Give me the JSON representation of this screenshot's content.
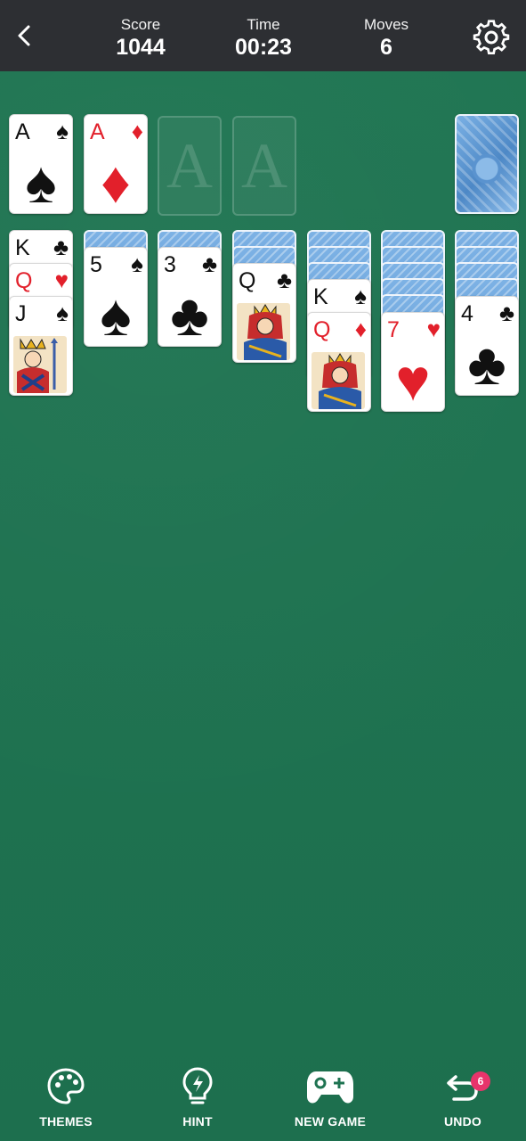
{
  "header": {
    "score_label": "Score",
    "score_value": "1044",
    "time_label": "Time",
    "time_value": "00:23",
    "moves_label": "Moves",
    "moves_value": "6"
  },
  "foundations": [
    {
      "rank": "A",
      "suit": "♠",
      "color": "black"
    },
    {
      "rank": "A",
      "suit": "♦",
      "color": "red"
    },
    {
      "placeholder": "A"
    },
    {
      "placeholder": "A"
    }
  ],
  "tableau": {
    "col1": [
      {
        "rank": "K",
        "suit": "♣"
      },
      {
        "rank": "Q",
        "suit": "♥"
      },
      {
        "rank": "J",
        "suit": "♠"
      }
    ],
    "col2": [
      {
        "rank": "5",
        "suit": "♠"
      }
    ],
    "col3": [
      {
        "rank": "3",
        "suit": "♣"
      }
    ],
    "col4": [
      {
        "rank": "Q",
        "suit": "♣"
      }
    ],
    "col5": [
      {
        "rank": "K",
        "suit": "♠"
      },
      {
        "rank": "Q",
        "suit": "♦"
      }
    ],
    "col6": [
      {
        "rank": "7",
        "suit": "♥"
      }
    ],
    "col7": [
      {
        "rank": "4",
        "suit": "♣"
      }
    ]
  },
  "toolbar": {
    "themes_label": "THEMES",
    "hint_label": "HINT",
    "new_game_label": "NEW GAME",
    "undo_label": "UNDO",
    "undo_badge": "6"
  },
  "colors": {
    "felt": "#1e7351",
    "topbar": "#2d2f33",
    "red_suit": "#e2202b",
    "badge": "#e8346b"
  }
}
